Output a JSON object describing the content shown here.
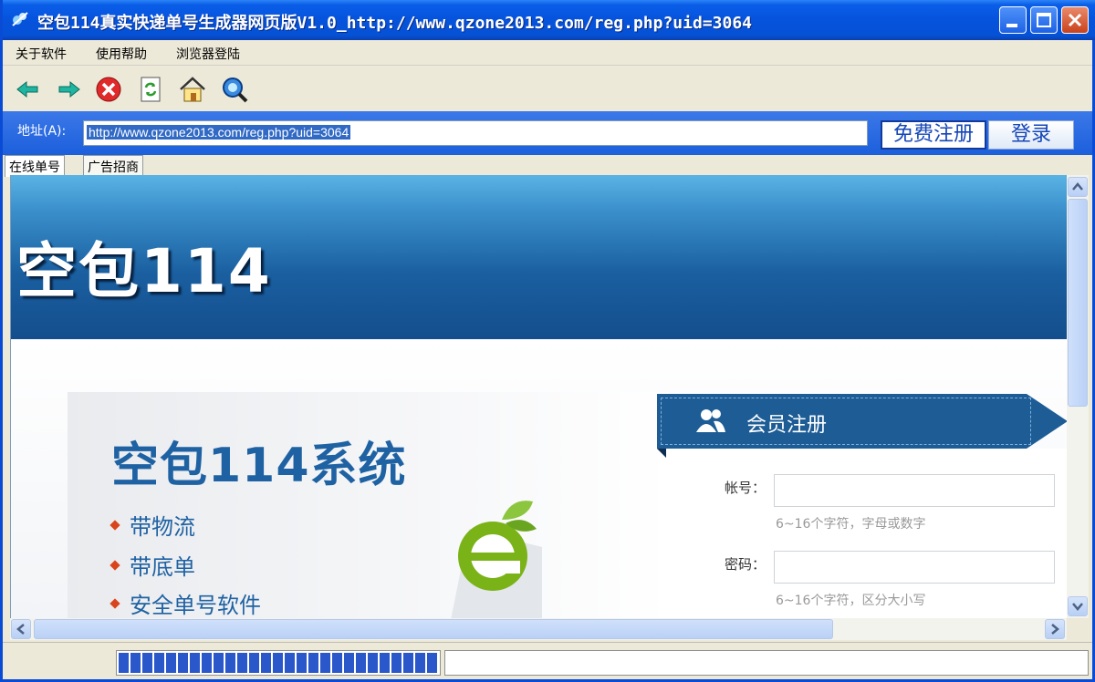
{
  "window": {
    "title": "空包114真实快递单号生成器网页版V1.0_http://www.qzone2013.com/reg.php?uid=3064"
  },
  "menu": [
    {
      "label": "关于软件"
    },
    {
      "label": "使用帮助"
    },
    {
      "label": "浏览器登陆"
    }
  ],
  "toolbar": {
    "icons": [
      "back-arrow-icon",
      "forward-arrow-icon",
      "stop-icon",
      "refresh-icon",
      "home-icon",
      "search-icon"
    ]
  },
  "address": {
    "label": "地址(A):",
    "url": "http://www.qzone2013.com/reg.php?uid=3064",
    "register_button": "免费注册",
    "login_button": "登录"
  },
  "tabs": [
    {
      "label": "在线单号",
      "active": true
    },
    {
      "label": "广告招商",
      "active": false
    }
  ],
  "page": {
    "banner_title": "空包114",
    "promo_title": "空包114系统",
    "promo_items": [
      "带物流",
      "带底单",
      "安全单号软件"
    ],
    "register_title": "会员注册",
    "fields": [
      {
        "label": "帐号：",
        "hint": "6~16个字符，字母或数字"
      },
      {
        "label": "密码：",
        "hint": "6~16个字符，区分大小写"
      }
    ]
  },
  "colors": {
    "titlebar": "#0653dc",
    "banner": "#1a5fa0",
    "accent": "#1f62a3",
    "bullet": "#d9441c"
  },
  "status": {
    "progress": 1.0
  }
}
